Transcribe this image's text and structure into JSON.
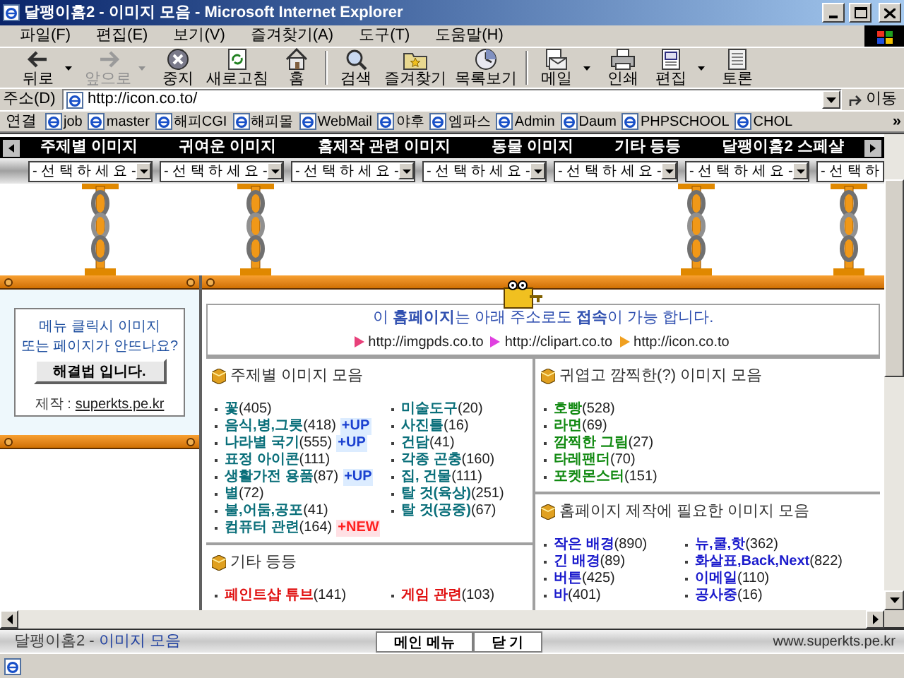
{
  "window": {
    "title": "달팽이홈2 - 이미지 모음 - Microsoft Internet Explorer"
  },
  "menu_bar": [
    "파일(F)",
    "편집(E)",
    "보기(V)",
    "즐겨찾기(A)",
    "도구(T)",
    "도움말(H)"
  ],
  "toolbar": [
    {
      "kind": "back",
      "label": "뒤로",
      "disabled": false,
      "dropdown": true
    },
    {
      "kind": "forward",
      "label": "앞으로",
      "disabled": true,
      "dropdown": true
    },
    {
      "kind": "stop",
      "label": "중지",
      "disabled": false,
      "dropdown": false
    },
    {
      "kind": "refresh",
      "label": "새로고침",
      "disabled": false,
      "dropdown": false
    },
    {
      "kind": "home",
      "label": "홈",
      "disabled": false,
      "dropdown": false
    },
    {
      "kind": "separator"
    },
    {
      "kind": "search",
      "label": "검색",
      "disabled": false,
      "dropdown": false
    },
    {
      "kind": "favorites",
      "label": "즐겨찾기",
      "disabled": false,
      "dropdown": false
    },
    {
      "kind": "history",
      "label": "목록보기",
      "disabled": false,
      "dropdown": false
    },
    {
      "kind": "separator"
    },
    {
      "kind": "mail",
      "label": "메일",
      "disabled": false,
      "dropdown": true
    },
    {
      "kind": "print",
      "label": "인쇄",
      "disabled": false,
      "dropdown": false
    },
    {
      "kind": "edit",
      "label": "편집",
      "disabled": false,
      "dropdown": true
    },
    {
      "kind": "discuss",
      "label": "토론",
      "disabled": false,
      "dropdown": false
    }
  ],
  "address_bar": {
    "label": "주소(D)",
    "value": "http://icon.co.to/",
    "go": "이동"
  },
  "links_bar": {
    "label": "연결",
    "links": [
      "job",
      "master",
      "해피CGI",
      "해피몰",
      "WebMail",
      "야후",
      "엠파스",
      "Admin",
      "Daum",
      "PHPSCHOOL",
      "CHOL"
    ],
    "more": "»"
  },
  "page": {
    "nav": [
      "주제별 이미지",
      "귀여운 이미지",
      "홈제작 관련 이미지",
      "동물 이미지",
      "기타 등등",
      "달팽이홈2 스페샬"
    ],
    "selects": [
      "- 선 택 하 세 요 -",
      "- 선 택 하 세 요 -",
      "- 선 택 하 세 요 -",
      "- 선 택 하 세 요 -",
      "- 선 택 하 세 요 -",
      "- 선 택 하 세 요 -",
      "- 선 택 하"
    ],
    "left_panel": {
      "notice_lines": [
        "메뉴 클릭시 이미지",
        "또는 페이지가 안뜨나요?"
      ],
      "button": "해결법 입니다.",
      "credit_label": "제작 :",
      "credit_link": "superkts.pe.kr"
    },
    "notice": {
      "text": "이 **홈페이지**는 아래 주소로도 **접속**이 가능 합니다.",
      "urls": [
        {
          "text": "http://imgpds.co.to",
          "color": "#e8407a"
        },
        {
          "text": "http://clipart.co.to",
          "color": "#e040e0"
        },
        {
          "text": "http://icon.co.to",
          "color": "#f0a020"
        }
      ]
    },
    "columns": [
      [
        {
          "title": "주제별 이미지 모음",
          "color": "#0a6f7a",
          "lists": [
            [
              {
                "name": "꽃",
                "count": "(405)"
              },
              {
                "name": "음식,병,그릇",
                "count": "(418)",
                "badge": {
                  "kind": "up",
                  "text": "+UP"
                }
              },
              {
                "name": "나라별 국기",
                "count": "(555)",
                "badge": {
                  "kind": "up",
                  "text": "+UP"
                }
              },
              {
                "name": "표정 아이콘",
                "count": "(111)"
              },
              {
                "name": "생활가전 용품",
                "count": "(87)",
                "badge": {
                  "kind": "up",
                  "text": "+UP"
                }
              },
              {
                "name": "별",
                "count": "(72)"
              },
              {
                "name": "불,어둠,공포",
                "count": "(41)"
              },
              {
                "name": "컴퓨터 관련",
                "count": "(164)",
                "badge": {
                  "kind": "new",
                  "text": "+NEW"
                }
              }
            ],
            [
              {
                "name": "미술도구",
                "count": "(20)"
              },
              {
                "name": "사진틀",
                "count": "(16)"
              },
              {
                "name": "건담",
                "count": "(41)"
              },
              {
                "name": "각종 곤충",
                "count": "(160)"
              },
              {
                "name": "집, 건물",
                "count": "(111)"
              },
              {
                "name": "탈 것(육상)",
                "count": "(251)"
              },
              {
                "name": "탈 것(공중)",
                "count": "(67)"
              }
            ]
          ]
        },
        {
          "title": "기타 등등",
          "color": "#e01010",
          "lists": [
            [
              {
                "name": "페인트샵 튜브",
                "count": "(141)"
              }
            ],
            [
              {
                "name": "게임 관련",
                "count": "(103)"
              }
            ]
          ]
        }
      ],
      [
        {
          "title": "귀엽고 깜찍한(?) 이미지 모음",
          "color": "#128a12",
          "lists": [
            [
              {
                "name": "호빵",
                "count": "(528)"
              },
              {
                "name": "라면",
                "count": "(69)"
              },
              {
                "name": "깜찍한 그림",
                "count": "(27)"
              },
              {
                "name": "타레팬더",
                "count": "(70)"
              },
              {
                "name": "포켓몬스터",
                "count": "(151)"
              }
            ]
          ]
        },
        {
          "title": "홈페이지 제작에 필요한 이미지 모음",
          "color": "#1a1acc",
          "lists": [
            [
              {
                "name": "작은 배경",
                "count": "(890)"
              },
              {
                "name": "긴 배경",
                "count": "(89)"
              },
              {
                "name": "버튼",
                "count": "(425)"
              },
              {
                "name": "바",
                "count": "(401)"
              }
            ],
            [
              {
                "name": "뉴,쿨,핫",
                "count": "(362)"
              },
              {
                "name": "화살표,Back,Next",
                "count": "(822)"
              },
              {
                "name": "이메일",
                "count": "(110)"
              },
              {
                "name": "공사중",
                "count": "(16)"
              }
            ]
          ]
        }
      ]
    ]
  },
  "bottom_frame": {
    "title": "달팽이홈2 - ",
    "title_link": "이미지 모음",
    "buttons": [
      "메인 메뉴",
      "닫 기"
    ],
    "site": "www.superkts.pe.kr"
  }
}
